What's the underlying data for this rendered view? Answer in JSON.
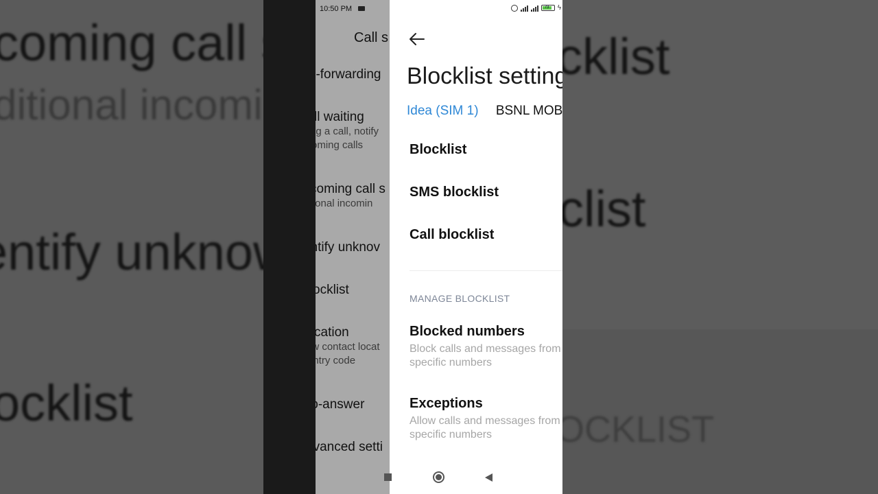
{
  "status_bar": {
    "time": "10:50 PM",
    "battery_level": "73"
  },
  "previous_screen": {
    "title": "Call s",
    "items": [
      {
        "title": "ll-forwarding",
        "subtitle": ""
      },
      {
        "title": "ll waiting",
        "subtitle": "ng a call, notify",
        "subtitle2": "oming calls"
      },
      {
        "title": "coming call s",
        "subtitle": "ditional incomin"
      },
      {
        "title": "entify unknov",
        "subtitle": ""
      },
      {
        "title": "ocklist",
        "subtitle": ""
      },
      {
        "title": "cation",
        "subtitle": "ow contact locat",
        "subtitle2": "untry code"
      },
      {
        "title": "to-answer",
        "subtitle": ""
      },
      {
        "title": "dvanced setti",
        "subtitle": ""
      }
    ]
  },
  "header": {
    "title": "Blocklist settings"
  },
  "tabs": [
    {
      "label": "Idea (SIM 1)",
      "active": true
    },
    {
      "label": "BSNL MOBILE",
      "active": false
    }
  ],
  "settings": [
    {
      "title": "Blocklist"
    },
    {
      "title": "SMS blocklist"
    },
    {
      "title": "Call blocklist"
    }
  ],
  "manage_section": {
    "heading": "MANAGE BLOCKLIST",
    "items": [
      {
        "title": "Blocked numbers",
        "subtitle_line1": "Block calls and messages from",
        "subtitle_line2": "specific numbers"
      },
      {
        "title": "Exceptions",
        "subtitle_line1": "Allow calls and messages from",
        "subtitle_line2": "specific numbers"
      }
    ]
  },
  "background_zoom_text": {
    "left_1": "coming call s",
    "left_2": "ditional incominc",
    "left_3": "entify unknow",
    "left_4": "ocklist",
    "right_1": "cklist",
    "right_2": "clist",
    "right_3": "OCKLIST"
  },
  "colors": {
    "accent": "#2f88d6",
    "section_heading": "#7d8697",
    "subtitle": "#a6a6a6"
  }
}
